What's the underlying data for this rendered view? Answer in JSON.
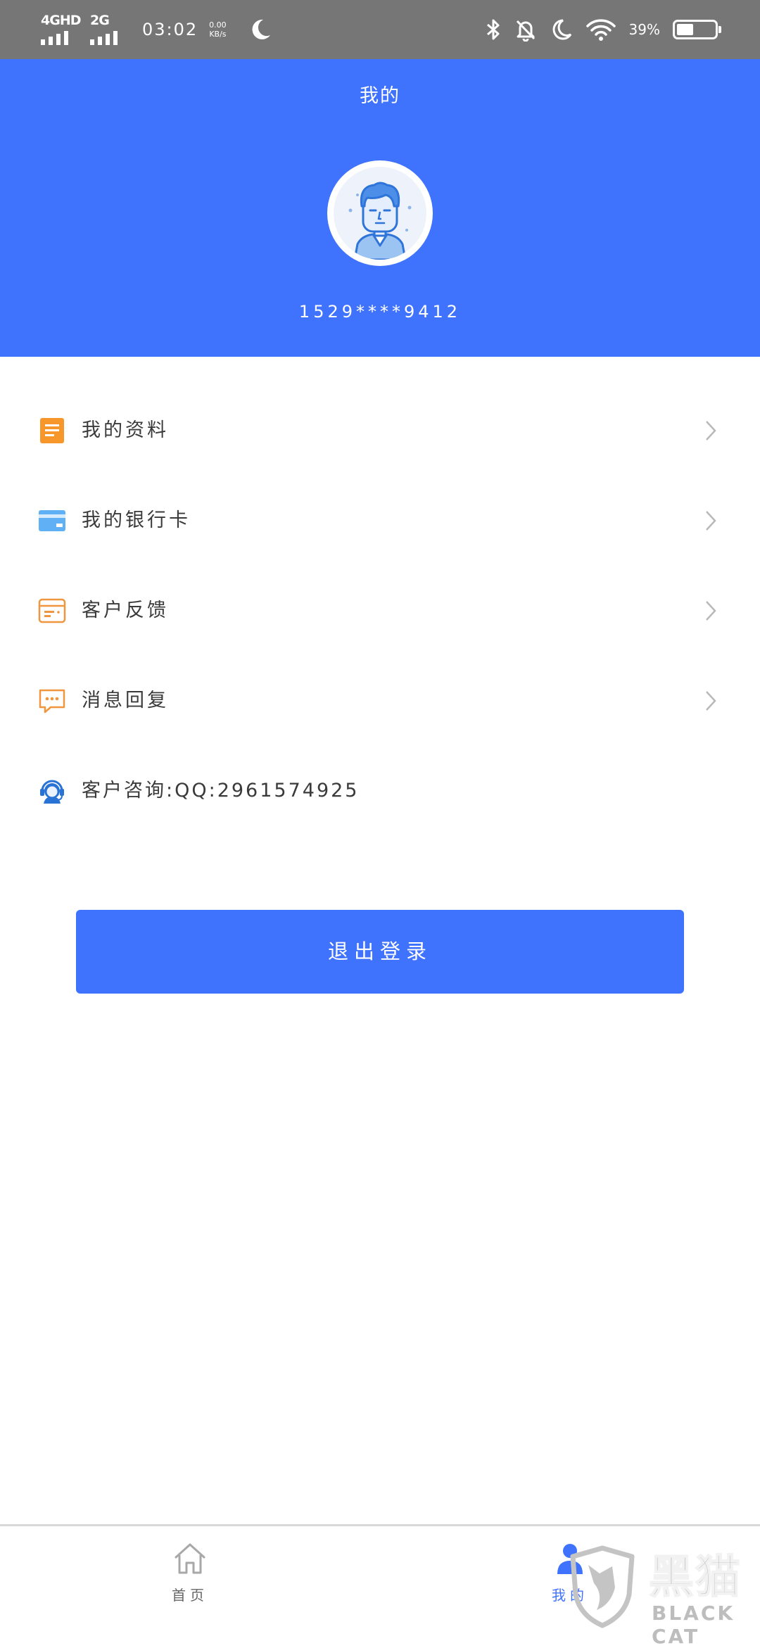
{
  "status_bar": {
    "network_1": "4GHD",
    "network_2": "2G",
    "time": "03:02",
    "speed_value": "0.00",
    "speed_unit": "KB/s",
    "battery_percent": "39%",
    "battery_level": 0.39
  },
  "header": {
    "title": "我的",
    "phone": "1529****9412"
  },
  "menu": [
    {
      "label": "我的资料",
      "icon": "profile-doc-icon",
      "color": "#f7962a"
    },
    {
      "label": "我的银行卡",
      "icon": "bank-card-icon",
      "color": "#4aa3f0"
    },
    {
      "label": "客户反馈",
      "icon": "feedback-card-icon",
      "color": "#f0963e"
    },
    {
      "label": "消息回复",
      "icon": "message-bubble-icon",
      "color": "#f0963e"
    },
    {
      "label": "客户咨询:QQ:2961574925",
      "icon": "customer-service-icon",
      "color": "#3f8fe0"
    }
  ],
  "logout_label": "退出登录",
  "tabbar": {
    "home_label": "首页",
    "mine_label": "我的"
  },
  "watermark": {
    "cn": "黑猫",
    "en": "BLACK CAT"
  },
  "colors": {
    "brand": "#3f72fd",
    "status_bar": "#767676"
  }
}
